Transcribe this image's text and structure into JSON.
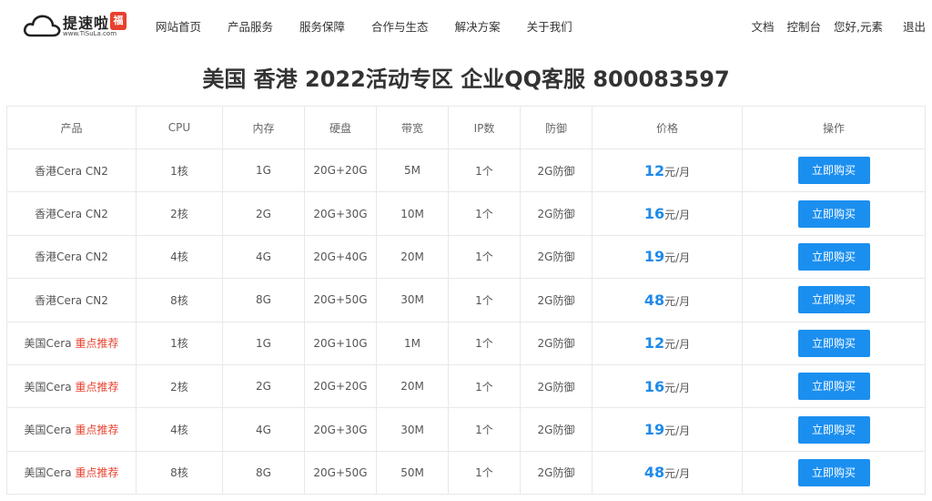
{
  "header": {
    "logo_name": "提速啦",
    "logo_badge": "福",
    "logo_url": "www.TiSuLa.com",
    "nav": [
      "网站首页",
      "产品服务",
      "服务保障",
      "合作与生态",
      "解决方案",
      "关于我们"
    ],
    "right": {
      "docs": "文档",
      "console": "控制台",
      "greeting": "您好,元素",
      "logout": "退出"
    }
  },
  "title": "美国 香港 2022活动专区 企业QQ客服 800083597",
  "table": {
    "headers": [
      "产品",
      "CPU",
      "内存",
      "硬盘",
      "带宽",
      "IP数",
      "防御",
      "价格",
      "操作"
    ],
    "rows": [
      {
        "product": "香港Cera CN2",
        "tag": "",
        "cpu": "1核",
        "ram": "1G",
        "disk": "20G+20G",
        "bw": "5M",
        "ip": "1个",
        "ddos": "2G防御",
        "price": "12",
        "unit": "元/月",
        "action": "立即购买"
      },
      {
        "product": "香港Cera CN2",
        "tag": "",
        "cpu": "2核",
        "ram": "2G",
        "disk": "20G+30G",
        "bw": "10M",
        "ip": "1个",
        "ddos": "2G防御",
        "price": "16",
        "unit": "元/月",
        "action": "立即购买"
      },
      {
        "product": "香港Cera CN2",
        "tag": "",
        "cpu": "4核",
        "ram": "4G",
        "disk": "20G+40G",
        "bw": "20M",
        "ip": "1个",
        "ddos": "2G防御",
        "price": "19",
        "unit": "元/月",
        "action": "立即购买"
      },
      {
        "product": "香港Cera CN2",
        "tag": "",
        "cpu": "8核",
        "ram": "8G",
        "disk": "20G+50G",
        "bw": "30M",
        "ip": "1个",
        "ddos": "2G防御",
        "price": "48",
        "unit": "元/月",
        "action": "立即购买"
      },
      {
        "product": "美国Cera",
        "tag": "重点推荐",
        "cpu": "1核",
        "ram": "1G",
        "disk": "20G+10G",
        "bw": "1M",
        "ip": "1个",
        "ddos": "2G防御",
        "price": "12",
        "unit": "元/月",
        "action": "立即购买"
      },
      {
        "product": "美国Cera",
        "tag": "重点推荐",
        "cpu": "2核",
        "ram": "2G",
        "disk": "20G+20G",
        "bw": "20M",
        "ip": "1个",
        "ddos": "2G防御",
        "price": "16",
        "unit": "元/月",
        "action": "立即购买"
      },
      {
        "product": "美国Cera",
        "tag": "重点推荐",
        "cpu": "4核",
        "ram": "4G",
        "disk": "20G+30G",
        "bw": "30M",
        "ip": "1个",
        "ddos": "2G防御",
        "price": "19",
        "unit": "元/月",
        "action": "立即购买"
      },
      {
        "product": "美国Cera",
        "tag": "重点推荐",
        "cpu": "8核",
        "ram": "8G",
        "disk": "20G+50G",
        "bw": "50M",
        "ip": "1个",
        "ddos": "2G防御",
        "price": "48",
        "unit": "元/月",
        "action": "立即购买"
      }
    ]
  },
  "colors": {
    "accent_blue": "#1b8ff0",
    "price_blue": "#1f8ae8",
    "recommend_red": "#e8402e",
    "border": "#e8e8e8"
  },
  "icons": {
    "logo": "cloud-logo-icon"
  }
}
